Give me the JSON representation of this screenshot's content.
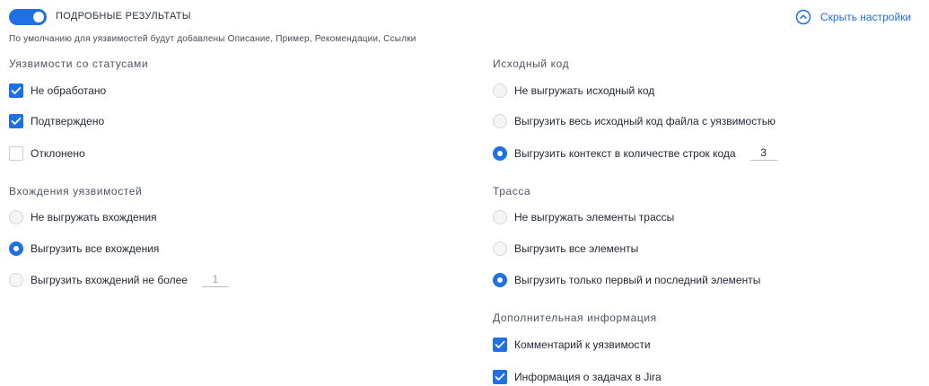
{
  "header": {
    "toggle_label": "ПОДРОБНЫЕ РЕЗУЛЬТАТЫ",
    "toggle_on": true,
    "note": "По умолчанию для уязвимостей будут добавлены Описание, Пример, Рекомендации, Ссылки",
    "hide_settings_label": "Скрыть настройки"
  },
  "statuses": {
    "title": "Уязвимости со статусами",
    "items": [
      {
        "label": "Не обработано",
        "checked": true
      },
      {
        "label": "Подтверждено",
        "checked": true
      },
      {
        "label": "Отклонено",
        "checked": false
      }
    ]
  },
  "occurrences": {
    "title": "Вхождения уязвимостей",
    "options": [
      {
        "label": "Не выгружать вхождения",
        "selected": false
      },
      {
        "label": "Выгрузить все вхождения",
        "selected": true
      },
      {
        "label": "Выгрузить вхождений не более",
        "selected": false,
        "value": "1"
      }
    ]
  },
  "source_code": {
    "title": "Исходный код",
    "options": [
      {
        "label": "Не выгружать исходный код",
        "selected": false
      },
      {
        "label": "Выгрузить весь исходный код файла с уязвимостью",
        "selected": false
      },
      {
        "label": "Выгрузить контекст в количестве строк кода",
        "selected": true,
        "value": "3"
      }
    ]
  },
  "trace": {
    "title": "Трасса",
    "options": [
      {
        "label": "Не выгружать элементы трассы",
        "selected": false
      },
      {
        "label": "Выгрузить все элементы",
        "selected": false
      },
      {
        "label": "Выгрузить только первый и последний элементы",
        "selected": true
      }
    ]
  },
  "extra": {
    "title": "Дополнительная информация",
    "items": [
      {
        "label": "Комментарий к уязвимости",
        "checked": true
      },
      {
        "label": "Информация о задачах в Jira",
        "checked": true
      }
    ]
  },
  "colors": {
    "accent": "#1f6fe5"
  },
  "icons": {
    "check": "check-icon",
    "collapse": "chevron-up-circle-icon"
  }
}
